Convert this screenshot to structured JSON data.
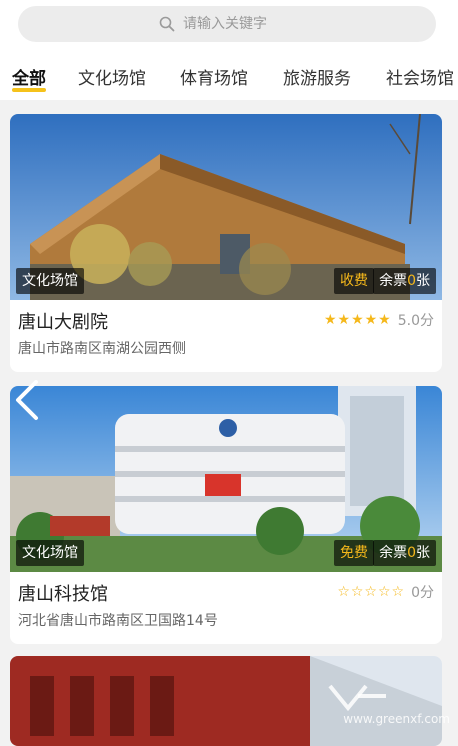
{
  "search": {
    "placeholder": "请输入关键字",
    "icon": "search-icon"
  },
  "tabs": [
    {
      "label": "全部",
      "active": true
    },
    {
      "label": "文化场馆"
    },
    {
      "label": "体育场馆"
    },
    {
      "label": "旅游服务"
    },
    {
      "label": "社会场馆"
    }
  ],
  "colors": {
    "accent": "#f5c21b",
    "star": "#f5b81b"
  },
  "venues": [
    {
      "name": "唐山大剧院",
      "address": "唐山市路南区南湖公园西侧",
      "category": "文化场馆",
      "fee": "收费",
      "tickets_prefix": "余票",
      "tickets": "0",
      "tickets_suffix": "张",
      "stars": "★★★★★",
      "score": "5.0分"
    },
    {
      "name": "唐山科技馆",
      "address": "河北省唐山市路南区卫国路14号",
      "category": "文化场馆",
      "fee": "免费",
      "tickets_prefix": "余票",
      "tickets": "0",
      "tickets_suffix": "张",
      "stars": "☆☆☆☆☆",
      "score": "0分"
    }
  ],
  "watermark": {
    "text": "www.greenxf.com"
  }
}
